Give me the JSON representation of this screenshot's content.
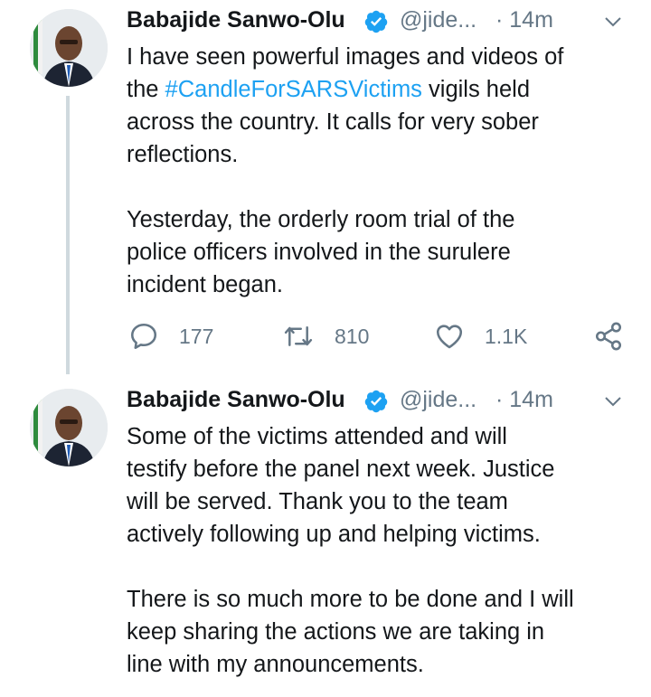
{
  "tweets": [
    {
      "author": "Babajide Sanwo-Olu",
      "handle": "@jide...",
      "time": "· 14m",
      "paragraphs": [
        {
          "lines": [
            [
              {
                "text": "I have seen powerful images and videos of"
              }
            ],
            [
              {
                "text": "the "
              },
              {
                "text": "#CandleForSARSVictims",
                "hashtag": true
              },
              {
                "text": " vigils held"
              }
            ],
            [
              {
                "text": "across the country. It calls for very sober"
              }
            ],
            [
              {
                "text": "reflections."
              }
            ]
          ]
        },
        {
          "lines": [
            [
              {
                "text": "Yesterday, the orderly room trial of the"
              }
            ],
            [
              {
                "text": "police officers involved in the surulere"
              }
            ],
            [
              {
                "text": "incident began."
              }
            ]
          ]
        }
      ],
      "stats": {
        "replies": "177",
        "retweets": "810",
        "likes": "1.1K"
      }
    },
    {
      "author": "Babajide Sanwo-Olu",
      "handle": "@jide...",
      "time": "· 14m",
      "paragraphs": [
        {
          "lines": [
            [
              {
                "text": "Some of the victims attended and will"
              }
            ],
            [
              {
                "text": "testify before the panel next week. Justice"
              }
            ],
            [
              {
                "text": "will be served. Thank you to the team"
              }
            ],
            [
              {
                "text": "actively following up and helping victims."
              }
            ]
          ]
        },
        {
          "lines": [
            [
              {
                "text": "There is so much more to be done and I will"
              }
            ],
            [
              {
                "text": "keep sharing the actions we are taking in"
              }
            ],
            [
              {
                "text": "line with my announcements."
              }
            ]
          ]
        }
      ]
    }
  ],
  "colors": {
    "accent": "#1da1f2",
    "verified": "#1da1f2",
    "muted": "#657786",
    "text": "#14171a",
    "thread_line": "#cfd9de"
  },
  "icons": [
    "verified-badge-icon",
    "chevron-down-icon",
    "reply-icon",
    "retweet-icon",
    "like-icon",
    "share-icon"
  ]
}
